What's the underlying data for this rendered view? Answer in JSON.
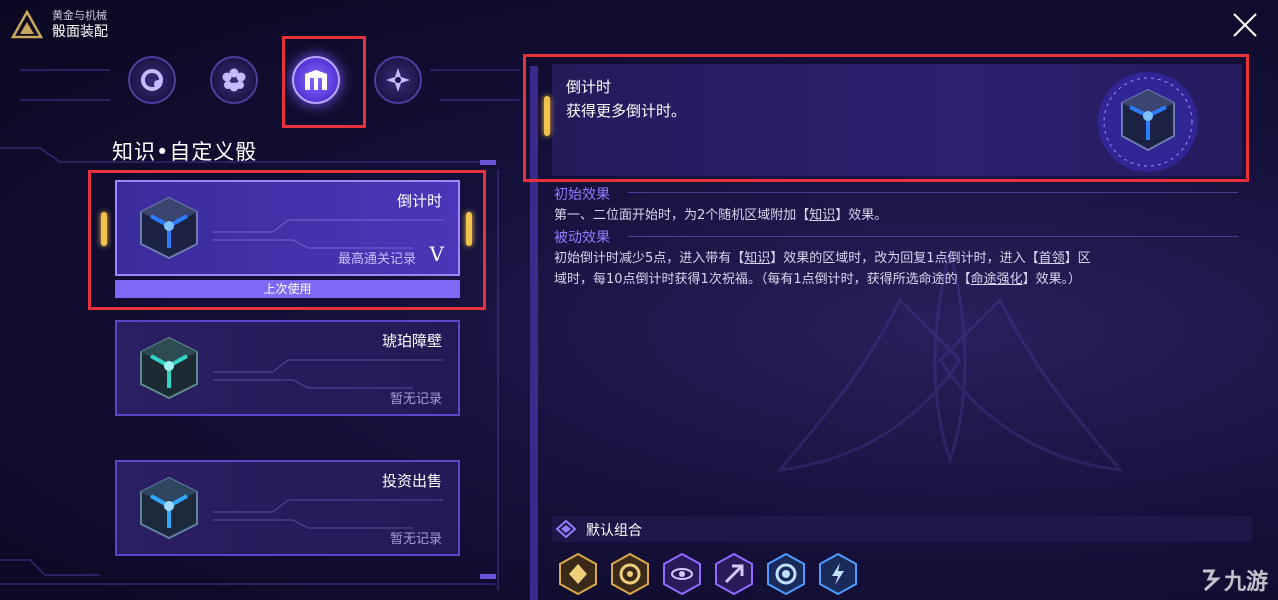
{
  "header": {
    "line1": "黄金与机械",
    "line2": "骰面装配"
  },
  "categories": [
    {
      "icon": "circle-gear-icon",
      "active": false
    },
    {
      "icon": "flower-icon",
      "active": false
    },
    {
      "icon": "pillars-icon",
      "active": true
    },
    {
      "icon": "star-icon",
      "active": false
    }
  ],
  "section_title": "知识•自定义骰",
  "cards": [
    {
      "name": "倒计时",
      "record": "最高通关记录",
      "rank": "V",
      "selected": true,
      "glow": "#2d7cff"
    },
    {
      "name": "琥珀障壁",
      "record": "暂无记录",
      "selected": false,
      "glow": "#2fd6c8"
    },
    {
      "name": "投资出售",
      "record": "暂无记录",
      "selected": false,
      "glow": "#2fa8ff"
    }
  ],
  "last_used": "上次使用",
  "detail": {
    "name": "倒计时",
    "desc": "获得更多倒计时。",
    "initial_title": "初始效果",
    "initial_pre": "第一、二位面开始时，为2个随机区域附加【",
    "initial_key": "知识",
    "initial_post": "】效果。",
    "passive_title": "被动效果",
    "passive_1": "初始倒计时减少5点，进入带有【",
    "passive_k1": "知识",
    "passive_2": "】效果的区域时，改为回复1点倒计时，进入【",
    "passive_k2": "首领",
    "passive_3": "】区",
    "passive_4": "域时，每10点倒计时获得1次祝福。（每有1点倒计时，获得所选命途的【",
    "passive_k3": "命途强化",
    "passive_5": "】效果。）"
  },
  "default_combo": {
    "label": "默认组合",
    "items": [
      "gold-diamond-icon",
      "gold-swirl-icon",
      "purple-eye-icon",
      "purple-arrow-icon",
      "blue-flower-icon",
      "blue-lightning-icon"
    ]
  },
  "watermark": "九游"
}
